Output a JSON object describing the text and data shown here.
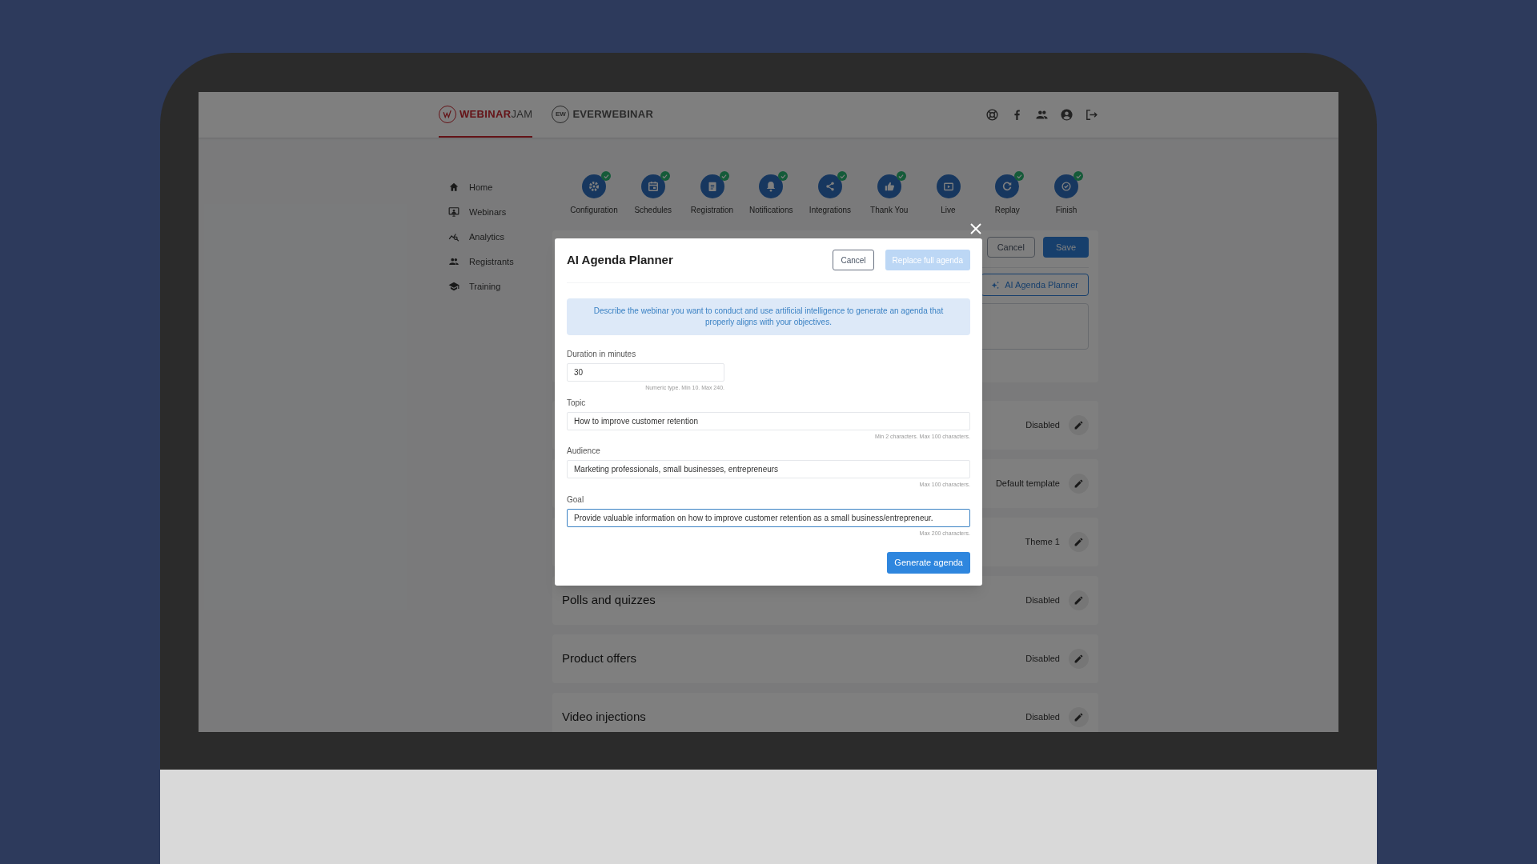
{
  "header": {
    "logos": [
      {
        "kind": "webinarjam",
        "lead": "WEBINAR",
        "rest": "JAM",
        "selected": true
      },
      {
        "kind": "everwebinar",
        "mark": "EW",
        "lead": "EVERWEBINAR",
        "selected": false
      }
    ],
    "icons": [
      {
        "kind": "help"
      },
      {
        "kind": "facebook"
      },
      {
        "kind": "people"
      },
      {
        "kind": "account"
      },
      {
        "kind": "logout"
      }
    ]
  },
  "sidebar": {
    "items": [
      {
        "label": "Home",
        "kind": "home"
      },
      {
        "label": "Webinars",
        "kind": "webinars"
      },
      {
        "label": "Analytics",
        "kind": "analytics"
      },
      {
        "label": "Registrants",
        "kind": "people"
      },
      {
        "label": "Training",
        "kind": "training"
      }
    ]
  },
  "steps": [
    {
      "label": "Configuration",
      "kind": "gear",
      "completed": true
    },
    {
      "label": "Schedules",
      "kind": "calendar",
      "completed": true
    },
    {
      "label": "Registration",
      "kind": "clipboard",
      "completed": true
    },
    {
      "label": "Notifications",
      "kind": "bell",
      "completed": true
    },
    {
      "label": "Integrations",
      "kind": "share",
      "completed": true
    },
    {
      "label": "Thank You",
      "kind": "thumb",
      "completed": true
    },
    {
      "label": "Live",
      "kind": "live",
      "completed": false
    },
    {
      "label": "Replay",
      "kind": "replay",
      "completed": true
    },
    {
      "label": "Finish",
      "kind": "finish",
      "completed": true
    }
  ],
  "editor": {
    "cancel": "Cancel",
    "save": "Save",
    "ai_button": "AI Agenda Planner"
  },
  "rows": [
    {
      "value": "Disabled"
    },
    {
      "value": "Default template"
    },
    {
      "value": "Theme 1"
    },
    {
      "title": "Polls and quizzes",
      "value": "Disabled"
    },
    {
      "title": "Product offers",
      "value": "Disabled"
    },
    {
      "title": "Video injections",
      "value": "Disabled"
    }
  ],
  "modal": {
    "title": "AI Agenda Planner",
    "cancel": "Cancel",
    "replace": {
      "label": "Replace full agenda",
      "disabled": true
    },
    "info": "Describe the webinar you want to conduct and use artificial intelligence to generate an agenda that properly aligns with your objectives.",
    "fields": [
      {
        "kind": "number",
        "label": "Duration in minutes",
        "value": "30",
        "hint": "Numeric type. Min 10. Max 240.",
        "focused": false
      },
      {
        "kind": "text",
        "label": "Topic",
        "value": "How to improve customer retention",
        "hint": "Min 2 characters. Max 100 characters.",
        "focused": false
      },
      {
        "kind": "text",
        "label": "Audience",
        "value": "Marketing professionals, small businesses, entrepreneurs",
        "hint": "Max 100 characters.",
        "focused": false
      },
      {
        "kind": "text",
        "label": "Goal",
        "value": "Provide valuable information on how to improve customer retention as a small business/entrepreneur.",
        "hint": "Max 200 characters.",
        "focused": true
      }
    ],
    "generate": "Generate agenda"
  }
}
